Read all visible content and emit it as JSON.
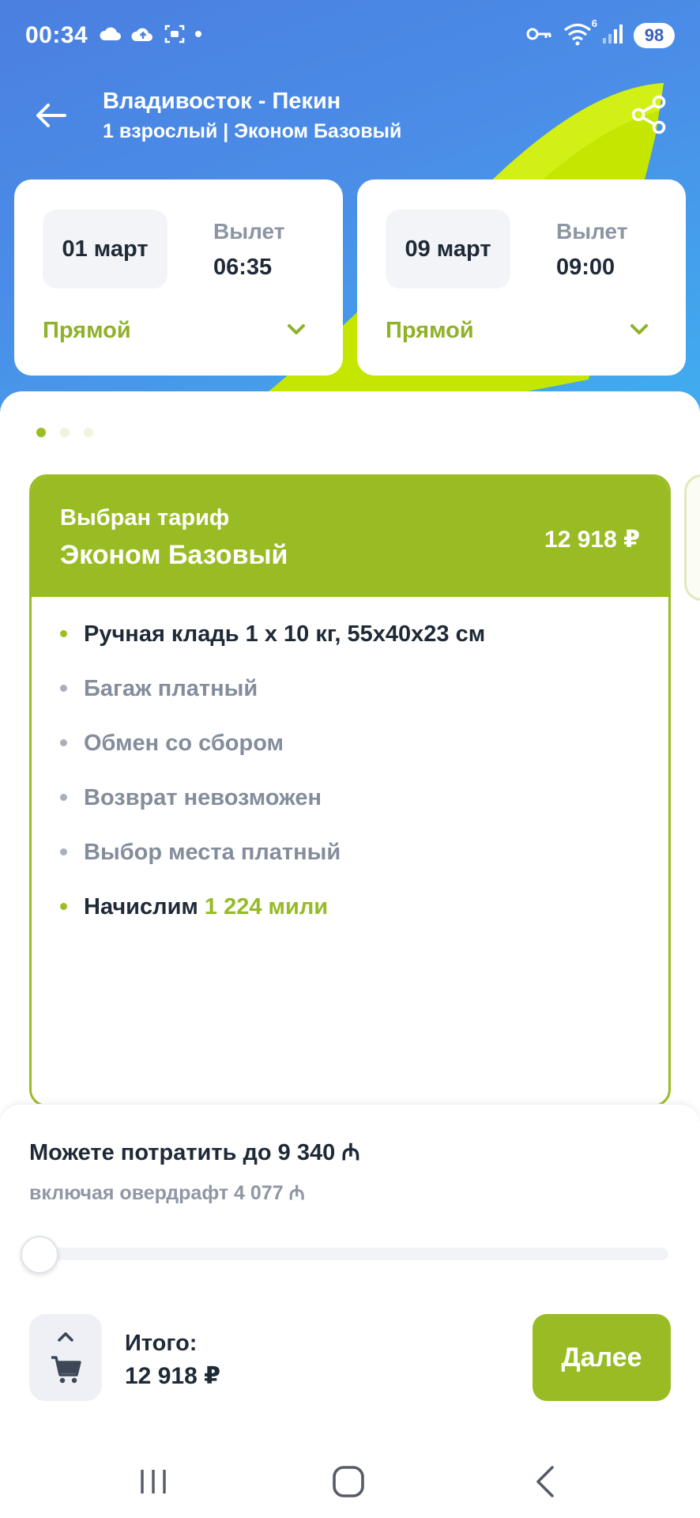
{
  "status_bar": {
    "time": "00:34",
    "battery": "98",
    "wifi_badge": "6"
  },
  "header": {
    "title": "Владивосток - Пекин",
    "subtitle": "1 взрослый | Эконом Базовый"
  },
  "flights": [
    {
      "date": "01 март",
      "departure_label": "Вылет",
      "departure_time": "06:35",
      "type": "Прямой"
    },
    {
      "date": "09 март",
      "departure_label": "Вылет",
      "departure_time": "09:00",
      "type": "Прямой"
    }
  ],
  "pager": {
    "current": 1,
    "total": 3
  },
  "tariff": {
    "caption": "Выбран тариф",
    "name": "Эконом Базовый",
    "price": "12 918 ₽",
    "features": [
      {
        "text": "Ручная кладь 1  х 10 кг, 55х40х23 см",
        "included": true
      },
      {
        "text": "Багаж платный",
        "included": false
      },
      {
        "text": "Обмен со сбором",
        "included": false
      },
      {
        "text": "Возврат невозможен",
        "included": false
      },
      {
        "text": "Выбор места платный",
        "included": false
      }
    ],
    "miles": {
      "prefix": "Начислим",
      "value": "1 224 мили"
    }
  },
  "miles_panel": {
    "title": "Можете потратить до 9 340 ₼",
    "subtitle": "включая овердрафт 4 077 ₼",
    "slider_value": 0
  },
  "footer": {
    "total_label": "Итого:",
    "total_value": "12 918 ₽",
    "next_label": "Далее"
  },
  "colors": {
    "accent_green": "#99bc24",
    "header_blue": "#4b7fe0",
    "text_dark": "#1f2a37",
    "text_muted": "#848d9c"
  }
}
